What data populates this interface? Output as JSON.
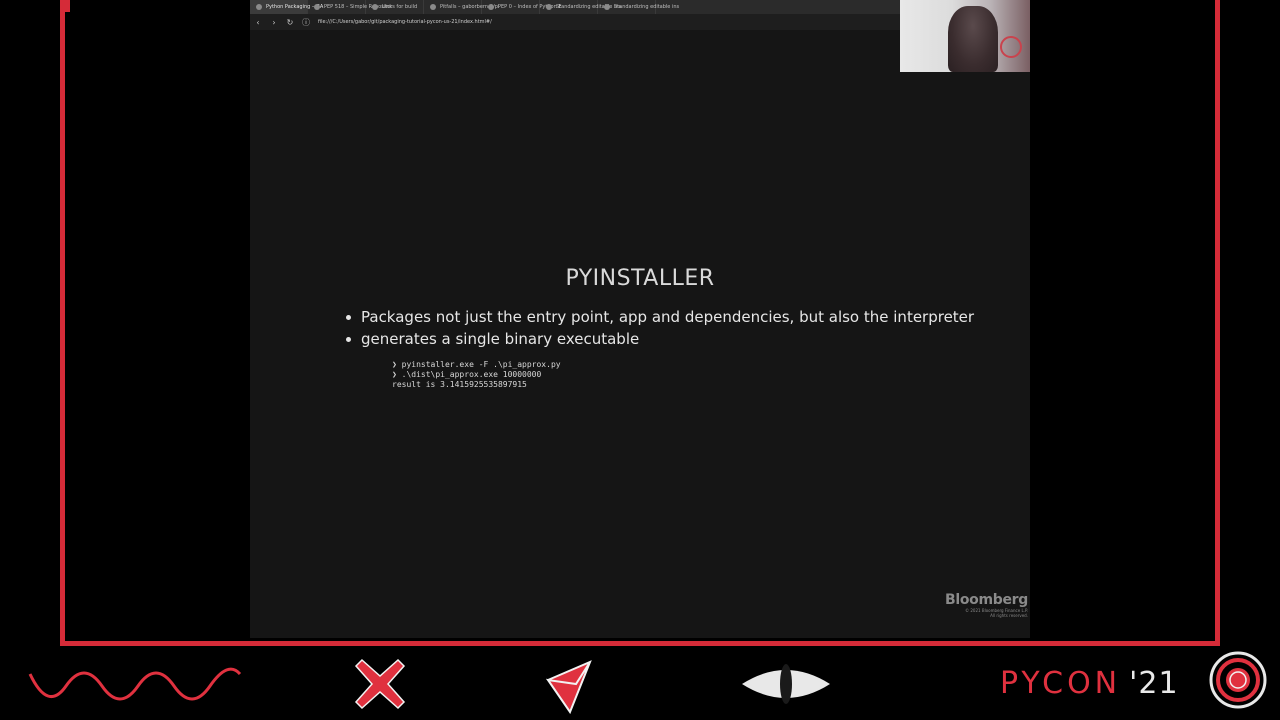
{
  "browser": {
    "tabs": [
      {
        "label": "Python Packaging – GA"
      },
      {
        "label": "PEP 518 – Simple Repositor"
      },
      {
        "label": "Links for build"
      },
      {
        "label": "Pitfalls – gaborbernat/pi"
      },
      {
        "label": "PEP 0 – Index of Python E"
      },
      {
        "label": "Standardizing editable ins"
      },
      {
        "label": "Standardizing editable ins"
      }
    ],
    "url": "file:///C:/Users/gabor/git/packaging-tutorial-pycon-us-21/index.html#/"
  },
  "slide": {
    "title": "PYINSTALLER",
    "bullets": [
      "Packages not just the entry point, app and dependencies, but also the interpreter",
      "generates a single binary executable"
    ],
    "code_lines": [
      "❯ pyinstaller.exe -F .\\pi_approx.py",
      "❯ .\\dist\\pi_approx.exe 10000000",
      "result is 3.1415925535897915"
    ],
    "sponsor": {
      "name": "Bloomberg",
      "copyright": "© 2021 Bloomberg Finance L.P.",
      "rights": "All rights reserved."
    }
  },
  "footer": {
    "brand": "PYCON",
    "year": "'21"
  },
  "colors": {
    "accent_red": "#d52b38",
    "slide_bg": "#151515",
    "text": "#e6e6e6"
  }
}
